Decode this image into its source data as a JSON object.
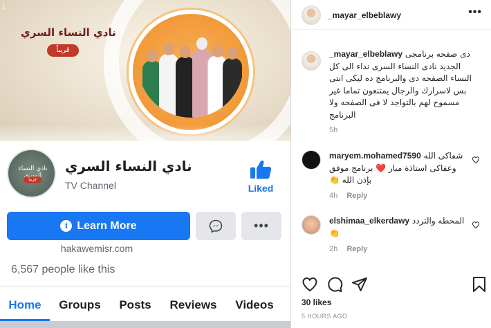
{
  "facebook_post": {
    "banner": {
      "show_title": "نادي النساء السري",
      "soon_badge": "قريباً",
      "banner_text": "نادي النساء السري"
    },
    "page": {
      "name": "نادي النساء السري",
      "category": "TV Channel",
      "like_label": "Liked",
      "avatar_text": "نادي النساء السري",
      "avatar_badge": "قريباً"
    },
    "buttons": {
      "learn_more": "Learn More",
      "more": "•••"
    },
    "website": "hakawemisr.com",
    "likes_count": "6,567 people like this",
    "tabs": [
      {
        "label": "Home"
      },
      {
        "label": "Groups"
      },
      {
        "label": "Posts"
      },
      {
        "label": "Reviews"
      },
      {
        "label": "Videos"
      }
    ],
    "colors": {
      "fb_blue": "#1877f2",
      "badge_red": "#c0392b",
      "orange": "#f19a3a"
    }
  },
  "instagram": {
    "header": {
      "username": "_mayar_elbeblawy",
      "more": "•••"
    },
    "caption": {
      "username": "_mayar_elbeblawy",
      "text": "دى صفحه برنامجى الجديد نادى النساء السرى نداء الى كل النساء الصفحه دى والبرنامج ده ليكى انتى بس لاسرارك والرجال يمتنعون تماما غير مسموح لهم بالتواجد لا فى الصفحه ولا البرنامج",
      "time": "5h"
    },
    "comments": [
      {
        "username": "maryem.mohamed7590",
        "text": "شفاكى الله وعفاكى استاذة ميار ❤️ برنامج موفق بإذن الله 👏",
        "time": "4h",
        "reply": "Reply"
      },
      {
        "username": "elshimaa_elkerdawy",
        "text": "المحطه والتردد 👏",
        "time": "2h",
        "reply": "Reply"
      }
    ],
    "likes": "30 likes",
    "timestamp": "5 HOURS AGO"
  }
}
